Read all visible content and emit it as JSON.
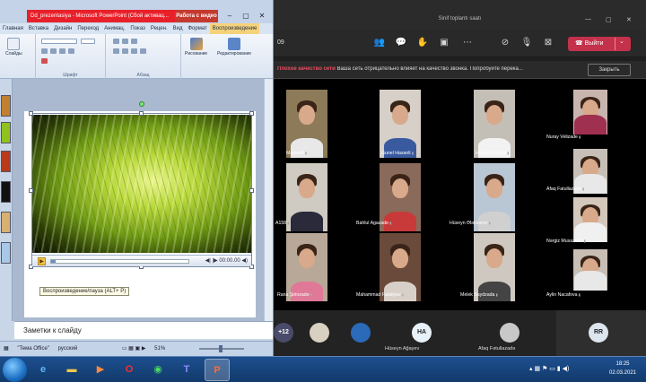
{
  "powerpoint": {
    "title": "Dd_prezentasiya - Microsoft PowerPoint (Сбой активац...",
    "context_tab": "Работа с видео",
    "menu": [
      "Главная",
      "Вставка",
      "Дизайн",
      "Переход",
      "Анимац.",
      "Показ",
      "Рецен.",
      "Вид",
      "Формат",
      "Воспроизведение"
    ],
    "ribbon": {
      "slides_label": "Слайды",
      "font_label": "Шрифт",
      "paragraph_label": "Абзац",
      "drawing_label": "Рисование",
      "editing_label": "Редактирование"
    },
    "player": {
      "time": "00:00.00",
      "tooltip": "Воспроизведение/пауза (ALT+ P)",
      "progress_fraction": 0.03
    },
    "notes_placeholder": "Заметки к слайду",
    "status": {
      "theme": "\"Тема Office\"",
      "language": "русский",
      "zoom": "51%"
    }
  },
  "teams": {
    "title": "Sinif toplantı saatı",
    "timer": "09",
    "leave_label": "Выйти",
    "warning_title": "Плохое качество сети",
    "warning_text": "Ваша сеть отрицательно влияет на качество звонка. Попробуйте перека...",
    "close_label": "Закрыть",
    "participants": [
      {
        "name": "Mamedli"
      },
      {
        "name": "Gunel Hasanli"
      },
      {
        "name": "Hüseyn Qədirli"
      },
      {
        "name": "Nuray Velizade"
      },
      {
        "name": "A158"
      },
      {
        "name": "Bahlul Agazade"
      },
      {
        "name": "Hüseyn Ələkbərov"
      },
      {
        "name": "Afaq Fatullazade"
      },
      {
        "name": "Nərgiz Musazade"
      },
      {
        "name": "Rana Şirinzadə"
      },
      {
        "name": "Mahammad Fataliyev"
      },
      {
        "name": "Melek Saydzada"
      },
      {
        "name": "Aylin Nacafova"
      }
    ],
    "bottom": {
      "overflow_count": "+12",
      "ha_initials": "HA",
      "ha_name": "Hüseyn Ağayev",
      "afaq_name": "Afaq Fətullazadə",
      "rr_initials": "RR"
    }
  },
  "taskbar": {
    "time": "18:25",
    "date": "02.03.2021"
  }
}
